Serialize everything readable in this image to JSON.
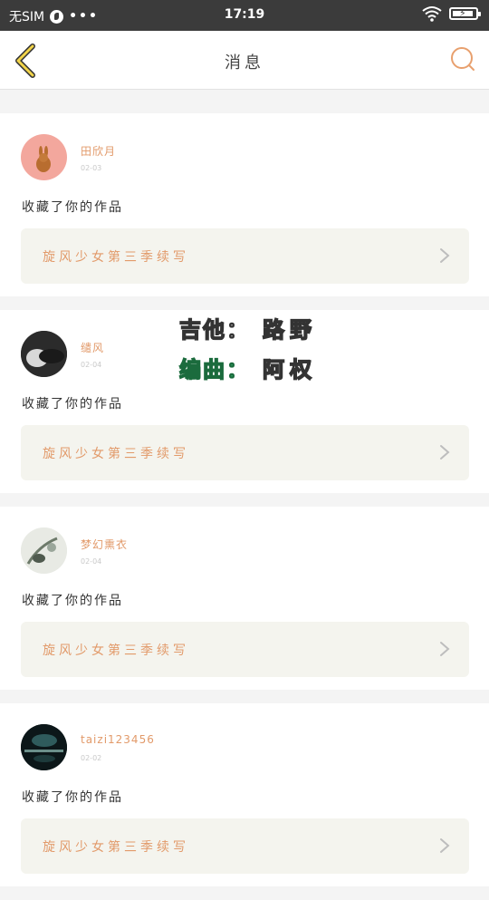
{
  "status_bar": {
    "carrier": "无SIM",
    "dots": "•••",
    "time": "17:19"
  },
  "header": {
    "title": "消息",
    "back_icon": "chevron-left-icon",
    "search_icon": "search-icon",
    "accent_color": "#e29a6a"
  },
  "notifications": [
    {
      "username": "田欣月",
      "date": "02-03",
      "action": "收藏了你的作品",
      "work_title": "旋风少女第三季续写",
      "avatar": "bunny"
    },
    {
      "username": "缱风",
      "date": "02-04",
      "action": "收藏了你的作品",
      "work_title": "旋风少女第三季续写",
      "avatar": "bw-portrait"
    },
    {
      "username": "梦幻熏衣",
      "date": "02-04",
      "action": "收藏了你的作品",
      "work_title": "旋风少女第三季续写",
      "avatar": "sketch"
    },
    {
      "username": "taizi123456",
      "date": "02-02",
      "action": "收藏了你的作品",
      "work_title": "旋风少女第三季续写",
      "avatar": "night-scene"
    }
  ],
  "overlay": {
    "line1_label": "吉他：",
    "line1_value": "路野",
    "line2_label": "编曲：",
    "line2_value": "阿权"
  }
}
